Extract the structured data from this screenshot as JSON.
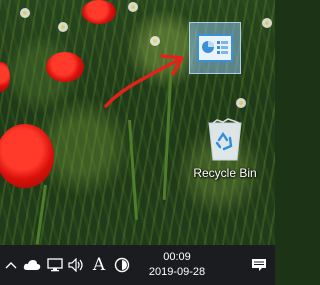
{
  "desktop": {
    "icons": [
      {
        "name": "dashboard-shortcut",
        "label": ""
      },
      {
        "name": "recycle-bin",
        "label": "Recycle Bin"
      }
    ]
  },
  "taskbar": {
    "tray_icons": [
      "chevron-up-icon",
      "onedrive-cloud-icon",
      "network-icon",
      "volume-icon",
      "ime-icon",
      "security-icon"
    ],
    "ime_label": "A",
    "clock": {
      "time": "00:09",
      "date": "2019-09-28"
    },
    "notification_icon": "notification-center-icon"
  },
  "colors": {
    "taskbar_bg": "#1a1c1f",
    "arrow": "#e2231a",
    "icon_highlight": "#8cbee6"
  }
}
